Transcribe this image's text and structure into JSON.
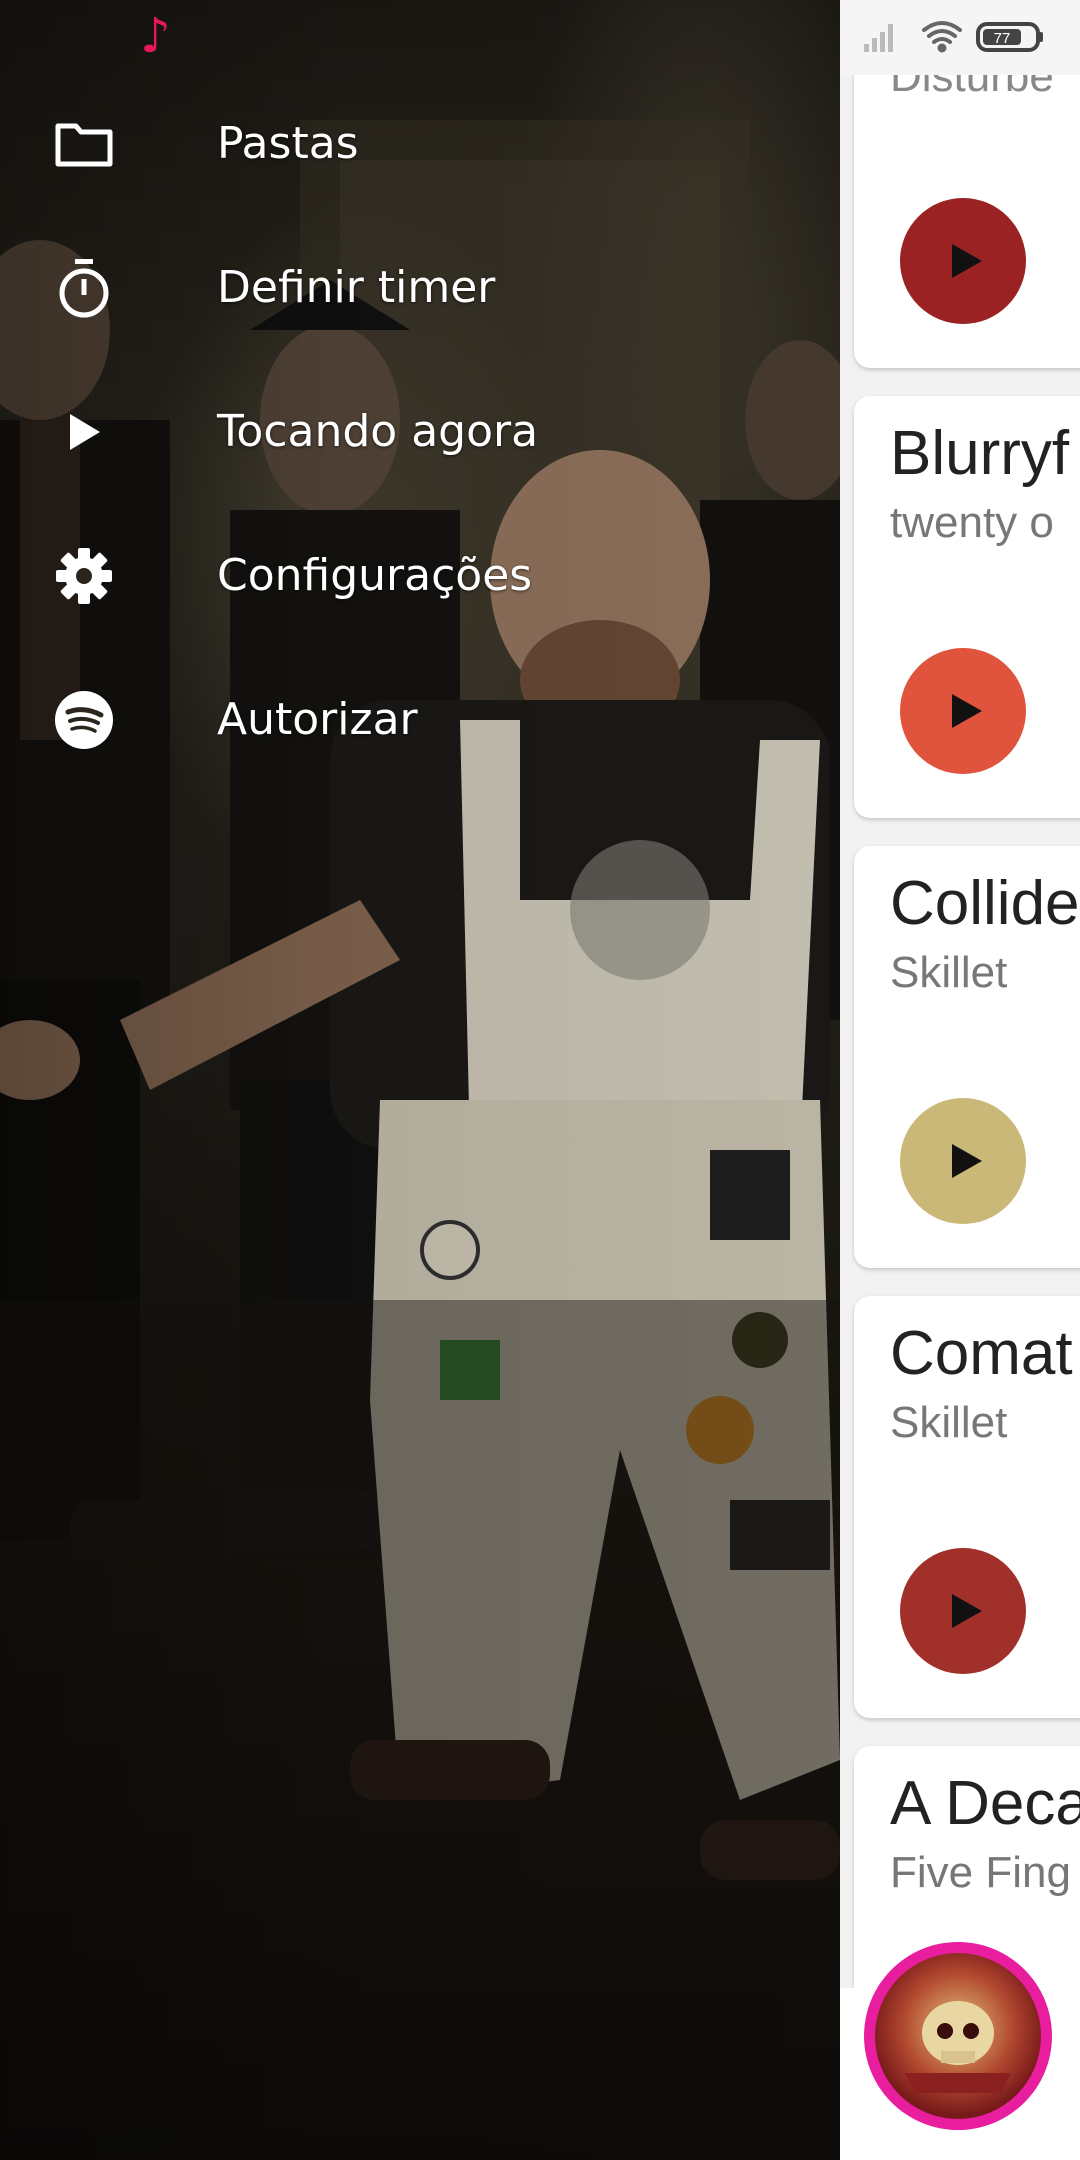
{
  "status_bar": {
    "left_icon": "music-note-icon",
    "battery": "77"
  },
  "drawer": {
    "menu": [
      {
        "label": "Pastas",
        "icon": "folder-icon"
      },
      {
        "label": "Definir timer",
        "icon": "timer-icon"
      },
      {
        "label": "Tocando agora",
        "icon": "play-icon"
      },
      {
        "label": "Configurações",
        "icon": "gear-icon"
      },
      {
        "label": "Autorizar",
        "icon": "spotify-icon"
      }
    ]
  },
  "songs": [
    {
      "title": "",
      "artist": "Disturbe",
      "button_color": "#9a2222"
    },
    {
      "title": "Blurryf",
      "artist": "twenty o",
      "button_color": "#e0533d"
    },
    {
      "title": "Collide",
      "artist": "Skillet",
      "button_color": "#c9b877"
    },
    {
      "title": "Comat",
      "artist": "Skillet",
      "button_color": "#a2302a"
    },
    {
      "title": "A Deca",
      "artist": "Five Fing",
      "button_color": ""
    }
  ],
  "colors": {
    "accent": "#e8175d",
    "avatar_ring": "#e91e9f"
  }
}
